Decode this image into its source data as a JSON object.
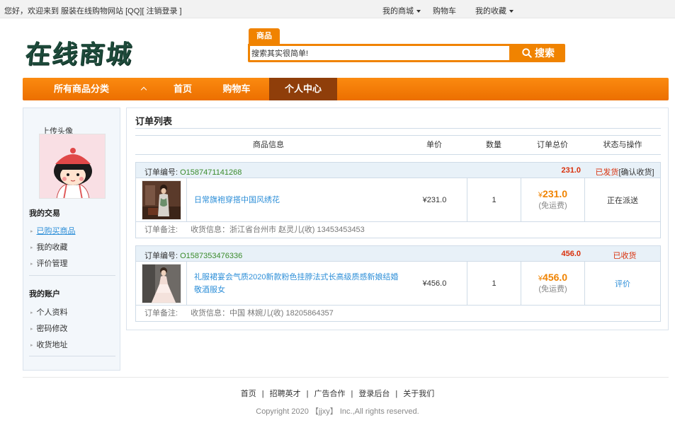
{
  "topbar": {
    "greeting": "您好，欢迎来到 服装在线购物网站",
    "qq": "[QQ]",
    "logout": "[ 注销登录 ]",
    "my_mall": "我的商城",
    "cart": "购物车",
    "favorites": "我的收藏"
  },
  "header": {
    "logo": "在线商城",
    "search_tab": "商品",
    "search_value": "搜索其实很简单!",
    "search_button": "搜索"
  },
  "nav": {
    "all_categories": "所有商品分类",
    "home": "首页",
    "cart": "购物车",
    "personal_center": "个人中心"
  },
  "sidebar": {
    "avatar_label": "上传头像",
    "trade_heading": "我的交易",
    "trade_items": [
      "已购买商品",
      "我的收藏",
      "评价管理"
    ],
    "account_heading": "我的账户",
    "account_items": [
      "个人资料",
      "密码修改",
      "收货地址"
    ]
  },
  "orders_panel": {
    "title": "订单列表",
    "columns": [
      "商品信息",
      "单价",
      "数量",
      "订单总价",
      "状态与操作"
    ],
    "order_no_label": "订单编号:",
    "note_label": "订单备注:",
    "orders": [
      {
        "order_no": "O1587471141268",
        "total": "231.0",
        "status": "已发货",
        "action": "[确认收货]",
        "product_name": "日常旗袍穿搭中国风绣花",
        "unit_price": "¥231.0",
        "quantity": "1",
        "yen": "¥",
        "total_big": "231.0",
        "shipping": "(免运费)",
        "operation": "正在派送",
        "shipping_info": "收货信息：浙江省台州市 赵灵儿(收) 13453453453"
      },
      {
        "order_no": "O1587353476336",
        "total": "456.0",
        "status": "已收货",
        "action": "",
        "product_name": "礼服裙宴会气质2020新款粉色挂脖法式长高级质感新娘结婚敬酒服女",
        "unit_price": "¥456.0",
        "quantity": "1",
        "yen": "¥",
        "total_big": "456.0",
        "shipping": "(免运费)",
        "operation": "评价",
        "shipping_info": "收货信息：中国 林婉儿(收) 18205864357"
      }
    ]
  },
  "footer": {
    "links": [
      "首页",
      "招聘英才",
      "广告合作",
      "登录后台",
      "关于我们"
    ],
    "separator": "|",
    "copyright": "Copyright 2020 【jjxy】 Inc.,All rights reserved."
  },
  "colors": {
    "accent_orange": "#f08300",
    "nav_active": "#8f3e0a",
    "price_red": "#d9300b",
    "link_blue": "#2e8fd8",
    "order_green": "#3a8b2b"
  },
  "icons": [
    "caret-down-icon",
    "search-icon",
    "chevron-up-icon",
    "bullet-icon",
    "avatar-cartoon-girl",
    "qipao-photo",
    "gown-photo"
  ]
}
